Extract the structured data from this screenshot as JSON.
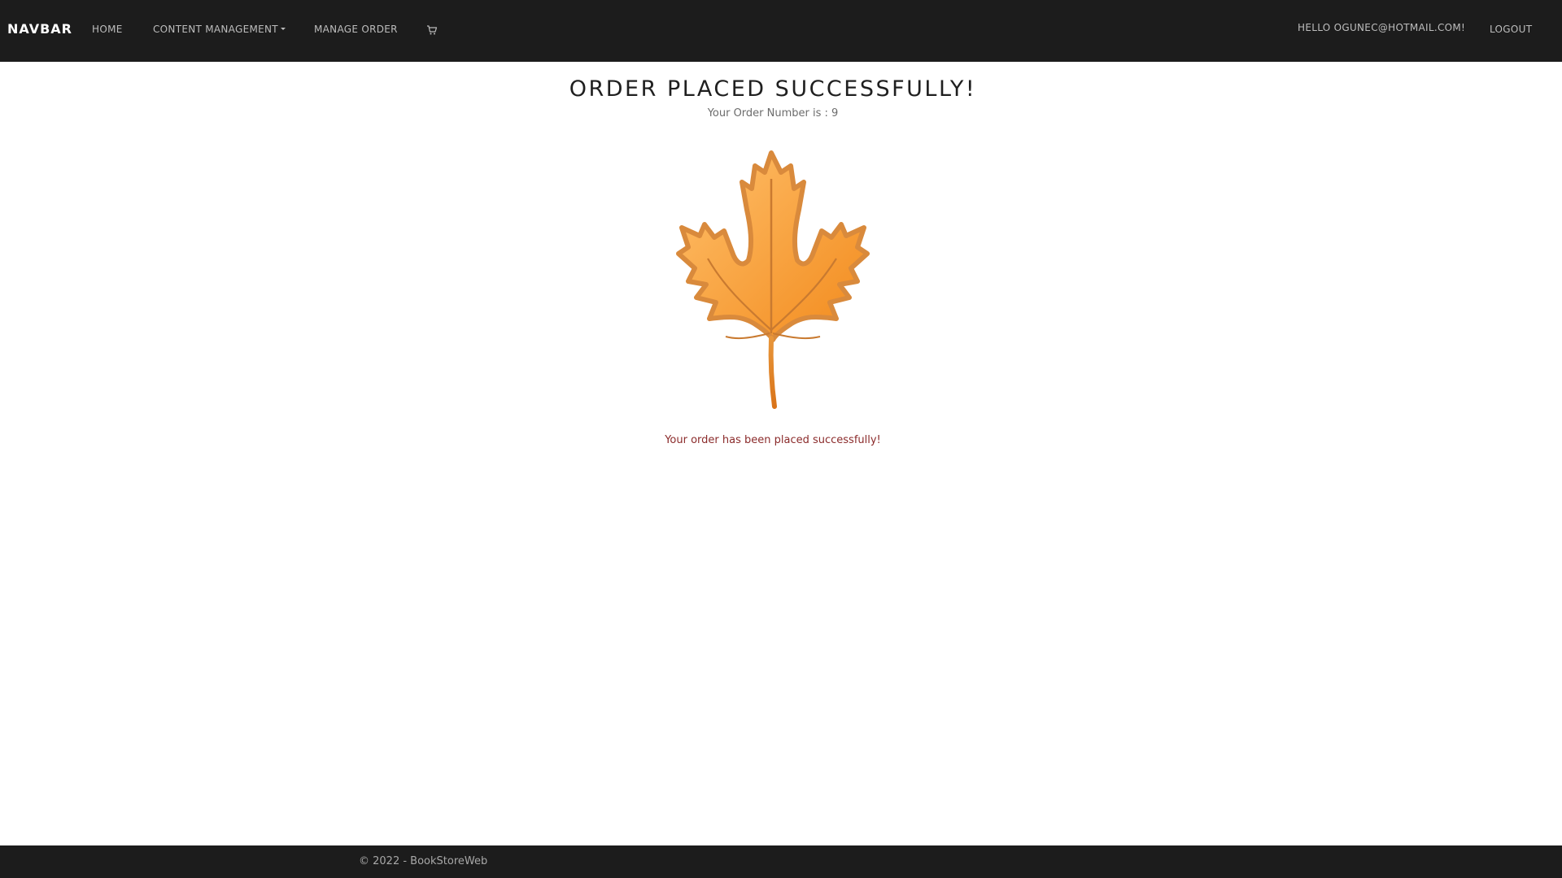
{
  "navbar": {
    "brand": "NAVBAR",
    "links": {
      "home": "HOME",
      "content_management": "CONTENT MANAGEMENT",
      "manage_order": "MANAGE ORDER"
    },
    "cart_icon": "cart-icon",
    "greeting": "HELLO OGUNEC@HOTMAIL.COM!",
    "logout": "LOGOUT"
  },
  "main": {
    "title": "ORDER PLACED SUCCESSFULLY!",
    "order_number_text": "Your Order Number is : 9",
    "image_icon": "maple-leaf-icon",
    "success_message": "Your order has been placed successfully!"
  },
  "footer": {
    "text": "© 2022 - BookStoreWeb"
  },
  "colors": {
    "navbar_bg": "#1c1c1c",
    "leaf_light": "#ffb55c",
    "leaf_dark": "#f28c1e",
    "leaf_outline": "#d98a3c",
    "success_text": "#8b2b2b"
  }
}
